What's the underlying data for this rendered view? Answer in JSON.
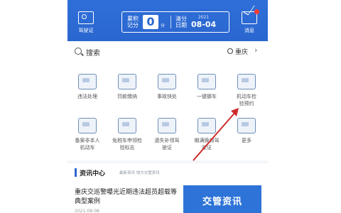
{
  "header": {
    "license_label": "驾驶证",
    "message_label": "消息",
    "points_label": "累积记分",
    "points_value": "0",
    "points_unit": "分",
    "clear_label": "清分日期",
    "clear_year": "2021",
    "clear_date": "08-04"
  },
  "search": {
    "placeholder": "搜索",
    "location": "重庆",
    "chevron": "›"
  },
  "services": [
    {
      "label": "违法处理",
      "icon": "car-icon"
    },
    {
      "label": "罚款缴纳",
      "icon": "receipt-icon"
    },
    {
      "label": "事故快处",
      "icon": "accident-icon"
    },
    {
      "label": "一键挪车",
      "icon": "phone-car-icon"
    },
    {
      "label": "机动车检验预约",
      "icon": "inspection-icon"
    },
    {
      "label": "备案非本人机动车",
      "icon": "document-icon"
    },
    {
      "label": "免税车申领检验标志",
      "icon": "diamond-icon"
    },
    {
      "label": "遗失补领驾驶证",
      "icon": "license-icon"
    },
    {
      "label": "期满换领驾驶证",
      "icon": "license-renew-icon"
    },
    {
      "label": "更多",
      "icon": "more-icon"
    }
  ],
  "news": {
    "title": "资讯中心",
    "subtitle": "最新资讯 地方交管资讯",
    "article_text": "重庆交巡警曝光近期违法超员超载等典型案例",
    "article_date": "2021-08-08",
    "banner_text": "交管资讯"
  },
  "colors": {
    "brand_blue": "#2a66cf",
    "annotation_arrow": "#cf2b2b"
  }
}
